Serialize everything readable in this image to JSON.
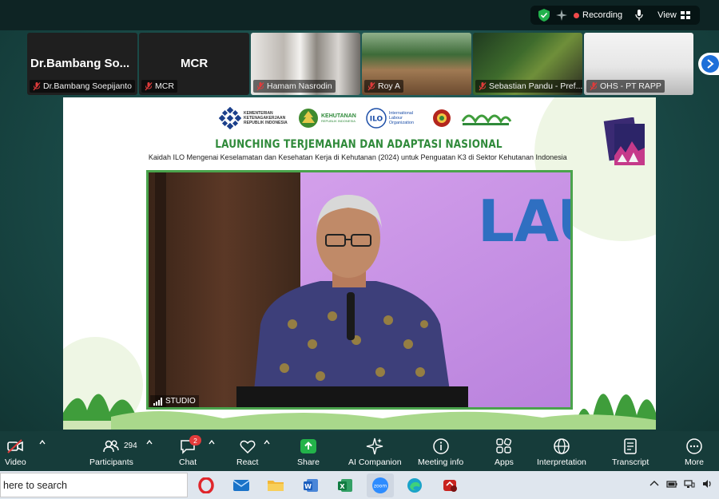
{
  "topbar": {
    "recording_label": "Recording",
    "view_label": "View"
  },
  "participants_strip": {
    "tiles": [
      {
        "big_name": "Dr.Bambang So...",
        "label": "Dr.Bambang Soepijanto"
      },
      {
        "big_name": "MCR",
        "label": "MCR"
      },
      {
        "label": "Hamam Nasrodin"
      },
      {
        "label": "Roy A"
      },
      {
        "label": "Sebastian Pandu - Pref..."
      },
      {
        "label": "OHS - PT RAPP"
      }
    ]
  },
  "share": {
    "logos": {
      "kemnaker": "KEMENTERIAN KETENAGAKERJAAN REPUBLIK INDONESIA",
      "kehutanan": "KEHUTANAN",
      "kehutanan_sub": "REPUBLIK INDONESIA",
      "ilo": "International Labour Organization",
      "ilo_mark": "ILO"
    },
    "headline": "LAUNCHING TERJEMAHAN DAN ADAPTASI NASIONAL",
    "subline": "Kaidah ILO Mengenai Keselamatan dan Kesehatan Kerja di Kehutanan (2024) untuk Penguatan K3 di Sektor Kehutanan Indonesia",
    "backdrop_text": "LAU",
    "studio_label": "STUDIO"
  },
  "toolbar": {
    "video": "Video",
    "participants": "Participants",
    "participants_count": "294",
    "chat": "Chat",
    "chat_badge": "2",
    "react": "React",
    "share": "Share",
    "ai_companion": "AI Companion",
    "meeting_info": "Meeting info",
    "apps": "Apps",
    "interpretation": "Interpretation",
    "transcript": "Transcript",
    "more": "More"
  },
  "taskbar": {
    "search_placeholder": "here to search",
    "apps": [
      "opera-icon",
      "mail-icon",
      "file-explorer-icon",
      "word-icon",
      "excel-icon",
      "zoom-icon",
      "edge-icon",
      "app-icon"
    ]
  },
  "colors": {
    "accent_green": "#2f8a3a",
    "recording_red": "#f04a4a",
    "toolbar_bg": "#163c3a"
  }
}
